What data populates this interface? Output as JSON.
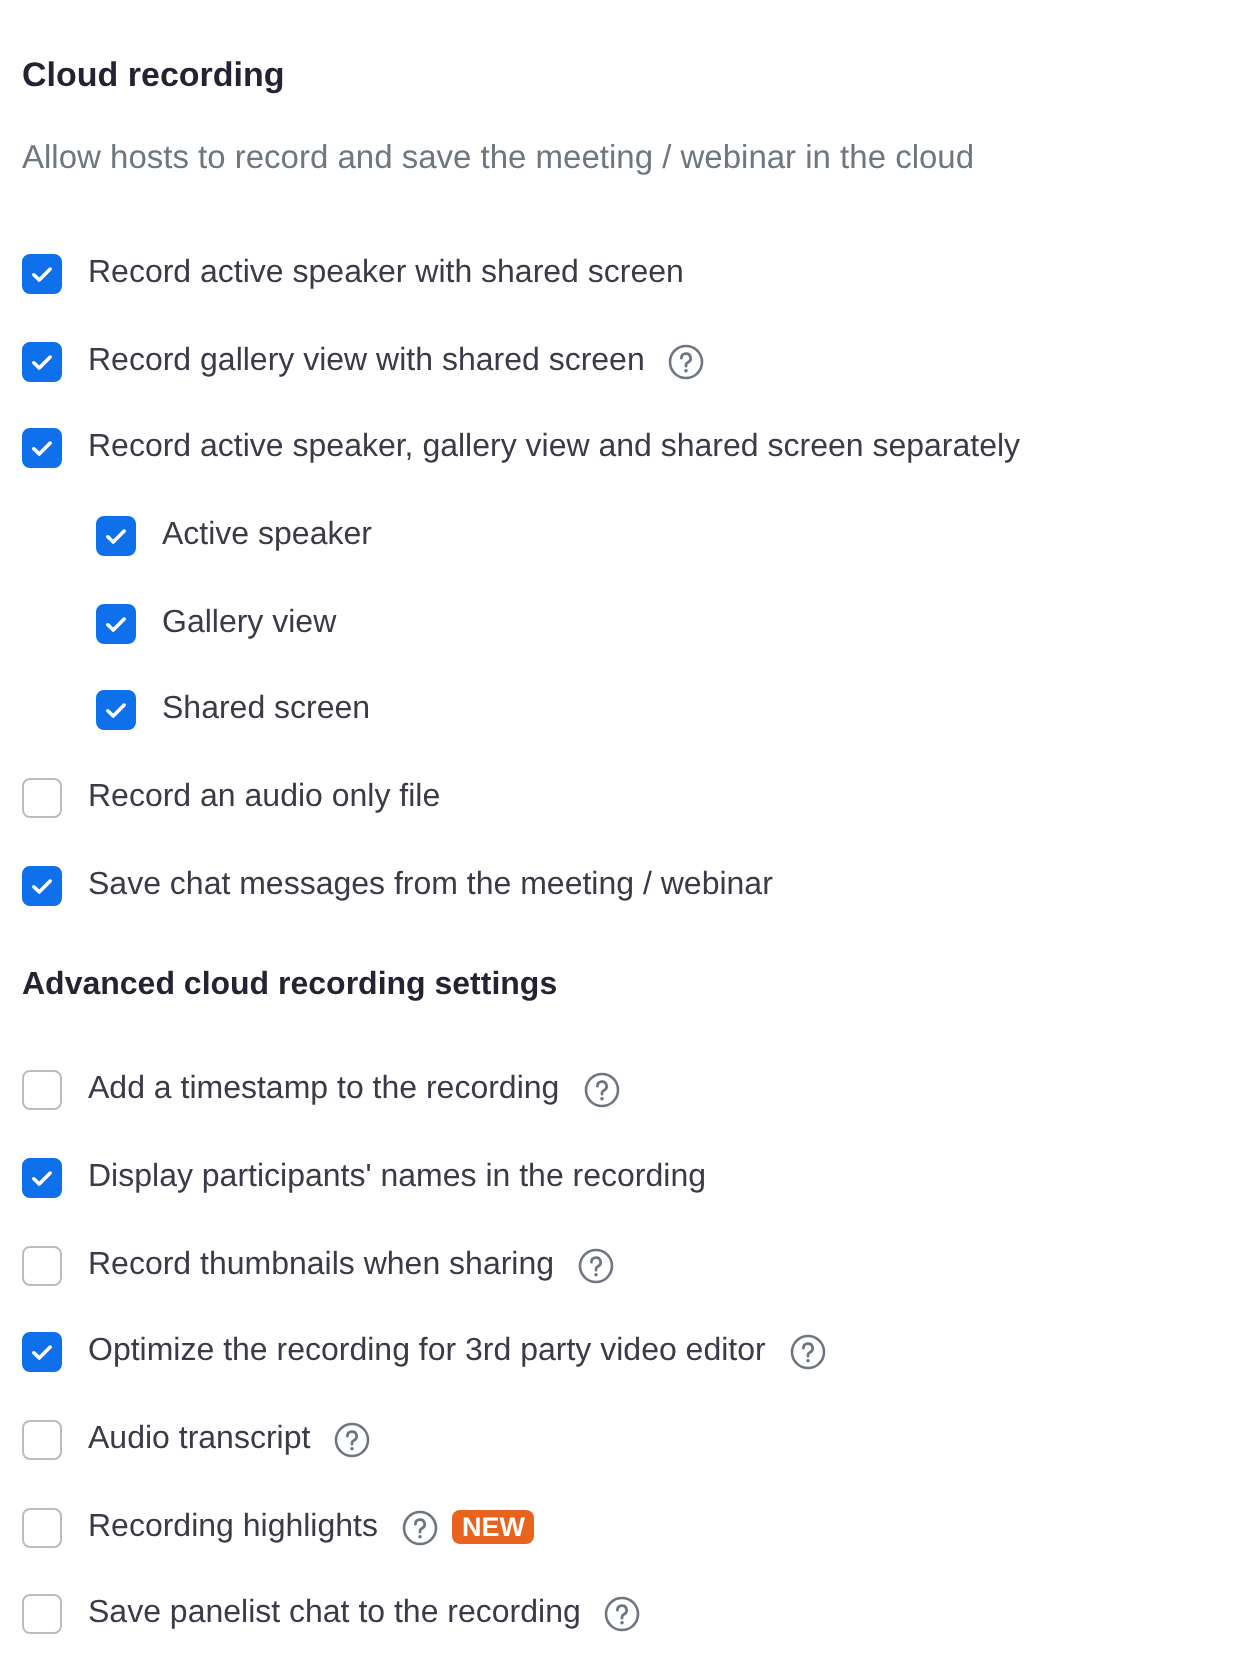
{
  "sections": [
    {
      "title": "Cloud recording",
      "description": "Allow hosts to record and save the meeting / webinar in the cloud",
      "options": [
        {
          "label": "Record active speaker with shared screen",
          "checked": true,
          "help": false
        },
        {
          "label": "Record gallery view with shared screen",
          "checked": true,
          "help": true
        },
        {
          "label": "Record active speaker, gallery view and shared screen separately",
          "checked": true,
          "help": false,
          "children": [
            {
              "label": "Active speaker",
              "checked": true,
              "help": false
            },
            {
              "label": "Gallery view",
              "checked": true,
              "help": false
            },
            {
              "label": "Shared screen",
              "checked": true,
              "help": false
            }
          ]
        },
        {
          "label": "Record an audio only file",
          "checked": false,
          "help": false
        },
        {
          "label": "Save chat messages from the meeting / webinar",
          "checked": true,
          "help": false
        }
      ]
    },
    {
      "title": "Advanced cloud recording settings",
      "options": [
        {
          "label": "Add a timestamp to the recording",
          "checked": false,
          "help": true
        },
        {
          "label": "Display participants' names in the recording",
          "checked": true,
          "help": false
        },
        {
          "label": "Record thumbnails when sharing",
          "checked": false,
          "help": true
        },
        {
          "label": "Optimize the recording for 3rd party video editor",
          "checked": true,
          "help": true
        },
        {
          "label": "Audio transcript",
          "checked": false,
          "help": true
        },
        {
          "label": "Recording highlights",
          "checked": false,
          "help": true,
          "badge": "NEW"
        },
        {
          "label": "Save panelist chat to the recording",
          "checked": false,
          "help": true
        }
      ]
    }
  ]
}
